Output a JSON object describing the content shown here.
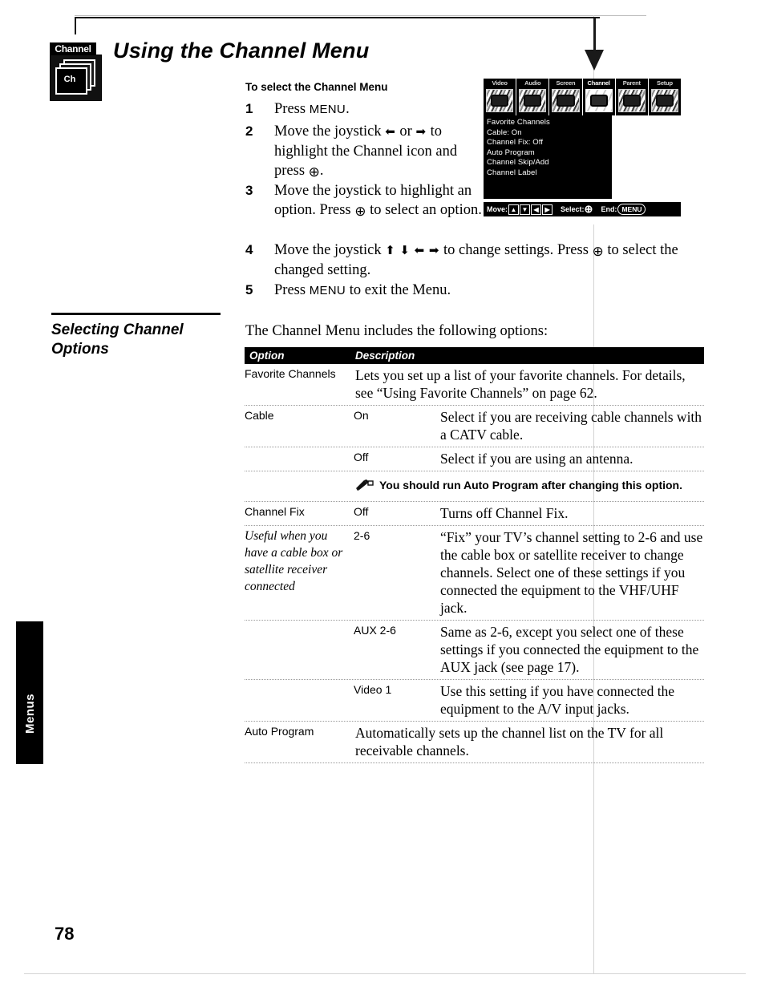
{
  "page": {
    "number": "78",
    "side_tab_label": "Menus",
    "title": "Using the Channel Menu",
    "badge": {
      "caption": "Channel",
      "inner_label": "Ch"
    }
  },
  "procedure": {
    "heading": "To select the Channel Menu",
    "steps": [
      {
        "num": "1",
        "text": "Press MENU.",
        "pre": "Press ",
        "kbd": "MENU",
        "post": "."
      },
      {
        "num": "2",
        "text": "Move the joystick ← or → to highlight the Channel icon and press ⊕."
      },
      {
        "num": "3",
        "text": "Move the joystick to highlight an option. Press ⊕ to select an option."
      },
      {
        "num": "4",
        "text": "Move the joystick ↑ ↓ ← → to change settings. Press ⊕ to select the changed setting."
      },
      {
        "num": "5",
        "text": "Press MENU to exit the Menu."
      }
    ]
  },
  "tv_screen": {
    "tabs": [
      {
        "name": "Video",
        "selected": false
      },
      {
        "name": "Audio",
        "selected": false
      },
      {
        "name": "Screen",
        "selected": false
      },
      {
        "name": "Channel",
        "selected": true
      },
      {
        "name": "Parent",
        "selected": false
      },
      {
        "name": "Setup",
        "selected": false
      }
    ],
    "menu_items": [
      "Favorite Channels",
      "Cable: On",
      "Channel Fix: Off",
      "Auto Program",
      "Channel Skip/Add",
      "Channel Label"
    ],
    "status_bar": {
      "move_label": "Move:",
      "dpad": [
        "▲",
        "▼",
        "◀",
        "▶"
      ],
      "select_label": "Select:",
      "select_glyph": "⊕",
      "end_label": "End:",
      "end_button": "MENU"
    }
  },
  "section": {
    "title_line1": "Selecting Channel",
    "title_line2": "Options",
    "intro": "The Channel Menu includes the following options:"
  },
  "table": {
    "headers": {
      "option": "Option",
      "description": "Description"
    },
    "rows": [
      {
        "option": "Favorite Channels",
        "value": "",
        "description": "Lets you set up a list of your favorite channels. For details, see “Using Favorite Channels” on page 62."
      },
      {
        "option": "Cable",
        "value": "On",
        "description": "Select if you are receiving cable channels with a CATV cable."
      },
      {
        "option": "",
        "value": "Off",
        "description": "Select if you are using an antenna."
      },
      {
        "option": "",
        "value": "",
        "note": "You should run Auto Program after changing this option.",
        "note_icon": "note-pencil-icon"
      },
      {
        "option": "Channel Fix",
        "option_subnote": "Useful when you have a cable box or satellite receiver connected",
        "value": "Off",
        "description": "Turns off Channel Fix."
      },
      {
        "option": "",
        "value": "2-6",
        "description": "“Fix” your TV’s channel setting to 2-6 and use the cable box or satellite receiver to change channels. Select one of these settings if you connected the equipment to the VHF/UHF jack."
      },
      {
        "option": "",
        "value": "AUX 2-6",
        "description": "Same as 2-6, except you select one of these settings if you connected the equipment to the AUX jack (see page 17)."
      },
      {
        "option": "",
        "value": "Video 1",
        "description": "Use this setting if you have connected the equipment to the A/V input jacks."
      },
      {
        "option": "Auto Program",
        "value": "",
        "description": "Automatically sets up the channel list on the TV for all receivable channels."
      }
    ]
  },
  "colors": {
    "ink": "#000000",
    "paper": "#ffffff",
    "rule": "#9a9a9a"
  }
}
